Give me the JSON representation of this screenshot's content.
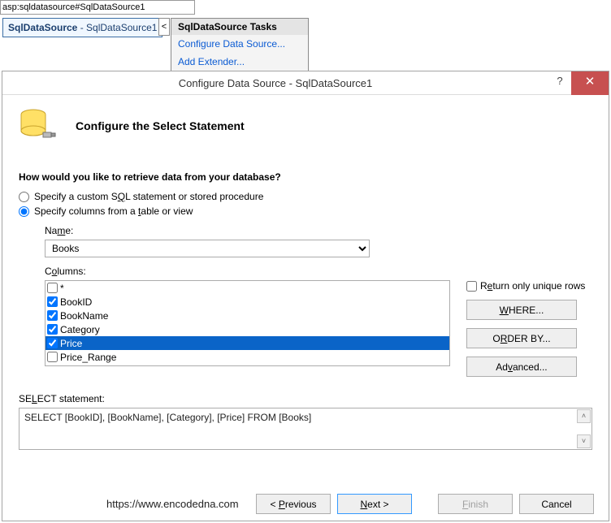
{
  "designer": {
    "addrbar": "asp:sqldatasource#SqlDataSource1",
    "controlLabelBold": "SqlDataSource",
    "controlLabelRest": " - SqlDataSource1",
    "tasksTitle": "SqlDataSource Tasks",
    "taskConfigure": "Configure Data Source...",
    "taskExtender": "Add Extender..."
  },
  "dialog": {
    "title": "Configure Data Source - SqlDataSource1",
    "heading": "Configure the Select Statement",
    "prompt": "How would you like to retrieve data from your database?",
    "optCustom": "Specify a custom SQL statement or stored procedure",
    "optColumns": "Specify columns from a table or view",
    "nameLabel": "Name:",
    "tableName": "Books",
    "columnsLabel": "Columns:",
    "columns": [
      {
        "label": "*",
        "checked": false,
        "selected": false
      },
      {
        "label": "BookID",
        "checked": true,
        "selected": false
      },
      {
        "label": "BookName",
        "checked": true,
        "selected": false
      },
      {
        "label": "Category",
        "checked": true,
        "selected": false
      },
      {
        "label": "Price",
        "checked": true,
        "selected": true
      },
      {
        "label": "Price_Range",
        "checked": false,
        "selected": false
      }
    ],
    "returnUnique": "Return only unique rows",
    "whereBtn": "WHERE...",
    "orderByBtn": "ORDER BY...",
    "advancedBtn": "Advanced...",
    "stmtLabel": "SELECT statement:",
    "stmtText": "SELECT [BookID], [BookName], [Category], [Price] FROM [Books]",
    "watermark": "https://www.encodedna.com",
    "prevBtn": "< Previous",
    "nextBtn": "Next >",
    "finishBtn": "Finish",
    "cancelBtn": "Cancel"
  }
}
